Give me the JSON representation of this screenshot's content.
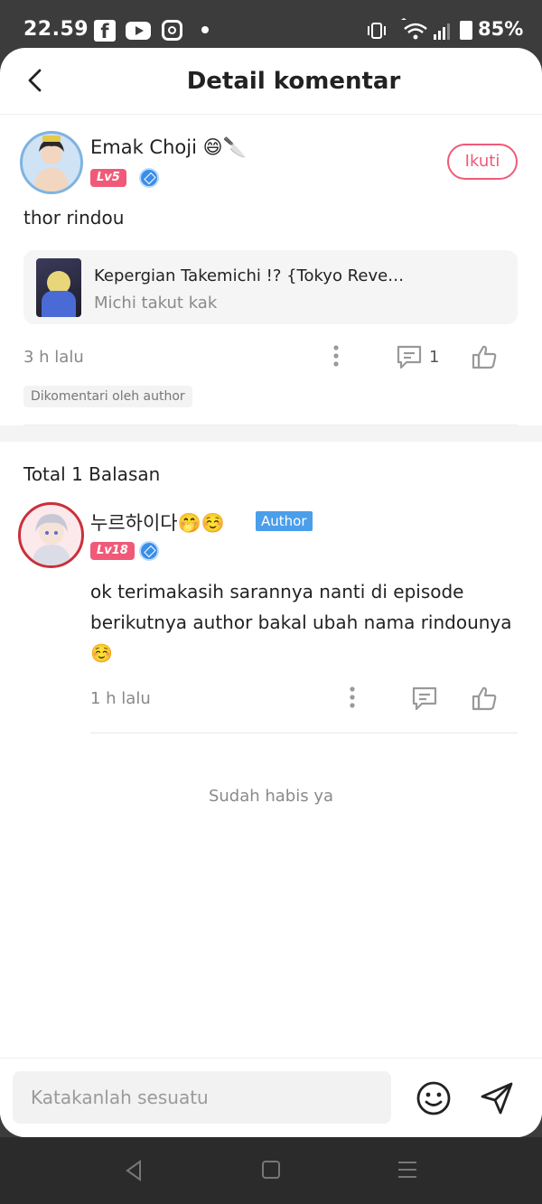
{
  "status_bar": {
    "time": "22.59",
    "battery": "85%",
    "icons": [
      "facebook-icon",
      "youtube-icon",
      "instagram-icon",
      "dot-icon",
      "vibrate-icon",
      "wifi-icon",
      "signal-icon",
      "battery-icon"
    ]
  },
  "header": {
    "title": "Detail komentar"
  },
  "comment": {
    "username": "Emak Choji 😄🔪",
    "level": "Lv5",
    "follow_label": "Ikuti",
    "text": "thor rindou",
    "story": {
      "title": "Kepergian Takemichi !? {Tokyo Reve…",
      "subtitle": "Michi takut kak"
    },
    "time": "3 h lalu",
    "reply_count": "1",
    "author_commented": "Dikomentari oleh author"
  },
  "replies": {
    "total_label": "Total 1 Balasan",
    "items": [
      {
        "username": "누르하이다🤭☺️",
        "author_label": "Author",
        "level": "Lv18",
        "text": "ok terimakasih sarannya nanti di episode berikutnya author bakal ubah nama rindounya ☺️",
        "time": "1 h lalu"
      }
    ],
    "end_text": "Sudah habis ya"
  },
  "input": {
    "placeholder": "Katakanlah sesuatu"
  },
  "colors": {
    "accent": "#f05a78",
    "author_tag": "#4a9eea",
    "verified": "#3a8ee8"
  }
}
